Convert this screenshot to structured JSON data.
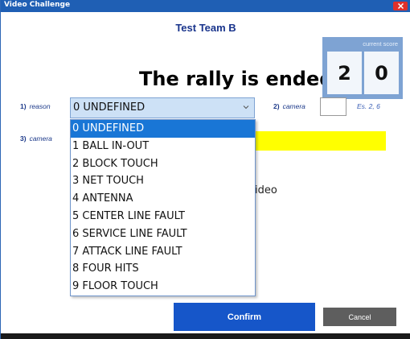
{
  "window": {
    "title": "Video Challenge",
    "close_icon": "close-icon"
  },
  "header": {
    "team": "Test Team B",
    "status": "The rally is ended"
  },
  "score": {
    "label": "current score",
    "home": "2",
    "away": "0"
  },
  "form": {
    "reason": {
      "number": "1)",
      "label": "reason",
      "value": "0 UNDEFINED"
    },
    "camera2": {
      "number": "2)",
      "label": "camera",
      "value": "",
      "hint": "Es. 2, 6"
    },
    "camera3": {
      "number": "3)",
      "label": "camera"
    },
    "partial_text": "ideo"
  },
  "dropdown": {
    "options": [
      "0 UNDEFINED",
      "1 BALL IN-OUT",
      "2 BLOCK TOUCH",
      "3 NET TOUCH",
      "4 ANTENNA",
      "5 CENTER LINE FAULT",
      "6 SERVICE LINE FAULT",
      "7 ATTACK LINE FAULT",
      "8 FOUR HITS",
      "9 FLOOR TOUCH"
    ],
    "selected_index": 0
  },
  "buttons": {
    "confirm": "Confirm",
    "cancel": "Cancel"
  },
  "colors": {
    "titlebar": "#1f5fb4",
    "accent": "#1656c9",
    "highlight": "#ffff00"
  }
}
